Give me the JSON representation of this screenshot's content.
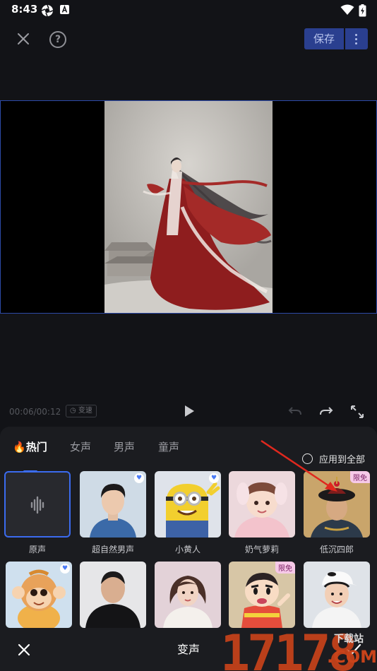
{
  "status_bar": {
    "time": "8:43"
  },
  "toolbar": {
    "save_label": "保存"
  },
  "playback": {
    "time": "00:06/00:12",
    "speed_badge": "变速"
  },
  "panel": {
    "tabs": [
      {
        "label": "热门",
        "active": true
      },
      {
        "label": "女声",
        "active": false
      },
      {
        "label": "男声",
        "active": false
      },
      {
        "label": "童声",
        "active": false
      }
    ],
    "apply_all_label": "应用到全部",
    "voices": [
      {
        "label": "原声",
        "badge": "",
        "selected": true
      },
      {
        "label": "超自然男声",
        "badge": "heart"
      },
      {
        "label": "小黄人",
        "badge": "heart"
      },
      {
        "label": "奶气萝莉",
        "badge": ""
      },
      {
        "label": "低沉四郎",
        "badge": "限免"
      },
      {
        "label": "",
        "badge": "heart"
      },
      {
        "label": "",
        "badge": ""
      },
      {
        "label": "",
        "badge": ""
      },
      {
        "label": "",
        "badge": "限免"
      },
      {
        "label": "",
        "badge": ""
      }
    ]
  },
  "bottom_bar": {
    "title": "变声"
  },
  "watermark": {
    "number": "17178",
    "suffix": ".COM",
    "cn": "下载站"
  },
  "colors": {
    "accent": "#3b6bef",
    "save_bg": "#2a3f8f",
    "watermark": "#c8431a",
    "free_badge": "#f6c9e8"
  }
}
